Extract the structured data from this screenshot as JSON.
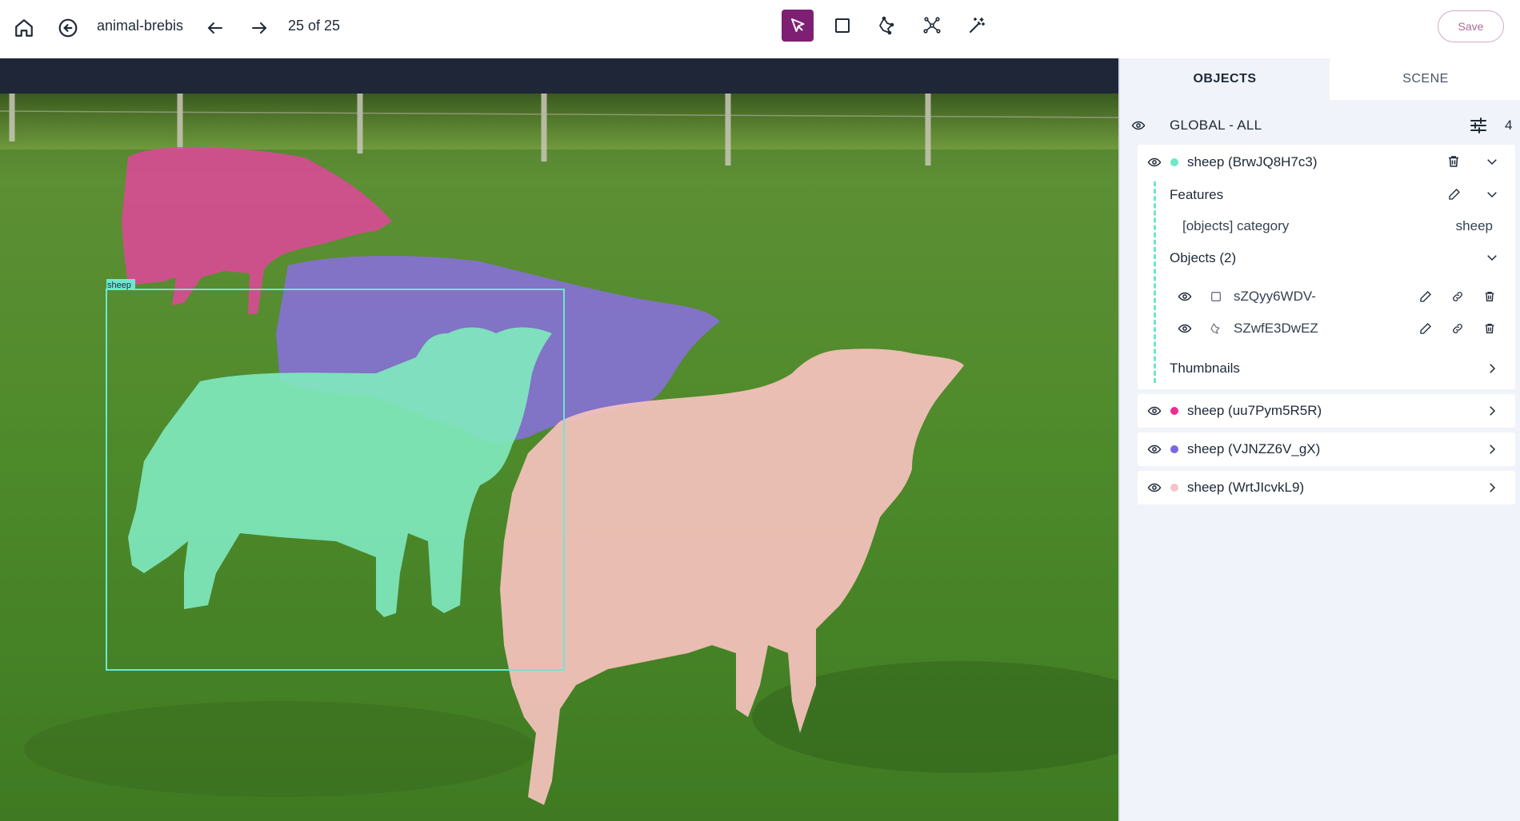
{
  "topbar": {
    "dataset_name": "animal-brebis",
    "position": "25 of 25",
    "save_label": "Save",
    "active_tool": "select-tool"
  },
  "canvas": {
    "bbox_label": "sheep",
    "colors": {
      "green_mask": "#7fe8bd",
      "purple_mask": "#8a6fe0",
      "pink_mask": "#e0479a",
      "salmon_mask": "#f5c2bc",
      "bbox": "#6ee7d0"
    }
  },
  "panel": {
    "tabs": [
      "OBJECTS",
      "SCENE"
    ],
    "global": {
      "label": "GLOBAL - ALL",
      "count": "4"
    },
    "objects": [
      {
        "title": "sheep (BrwJQ8H7c3)",
        "color": "#6ee7c7",
        "expanded": true,
        "features_label": "Features",
        "features": [
          {
            "key": "[objects] category",
            "value": "sheep"
          }
        ],
        "objects_label": "Objects (2)",
        "children": [
          {
            "name": "sZQyy6WDV-",
            "type_icon": "box-icon"
          },
          {
            "name": "SZwfE3DwEZ",
            "type_icon": "polygon-icon"
          }
        ],
        "thumbnails_label": "Thumbnails"
      },
      {
        "title": "sheep (uu7Pym5R5R)",
        "color": "#ec2f8e",
        "expanded": false
      },
      {
        "title": "sheep (VJNZZ6V_gX)",
        "color": "#7c66e6",
        "expanded": false
      },
      {
        "title": "sheep (WrtJIcvkL9)",
        "color": "#f7c4cc",
        "expanded": false
      }
    ]
  }
}
